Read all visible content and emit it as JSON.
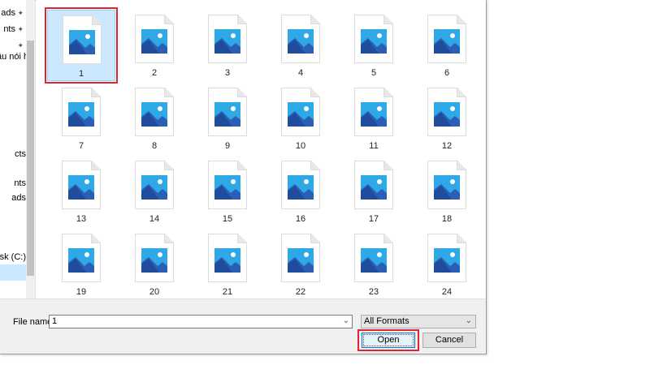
{
  "navigation": {
    "items": [
      {
        "label": "ads",
        "pinned": true
      },
      {
        "label": "nts",
        "pinned": true
      },
      {
        "label": "",
        "pinned": true
      },
      {
        "label": "âu nói h",
        "pinned": false
      },
      {
        "label": "cts",
        "pinned": false
      },
      {
        "label": "nts",
        "pinned": false
      },
      {
        "label": "ads",
        "pinned": false
      },
      {
        "label": "sk (C:)",
        "pinned": false
      }
    ],
    "pin_glyph": "📌"
  },
  "files": [
    {
      "name": "1",
      "selected": true
    },
    {
      "name": "2"
    },
    {
      "name": "3"
    },
    {
      "name": "4"
    },
    {
      "name": "5"
    },
    {
      "name": "6"
    },
    {
      "name": "7"
    },
    {
      "name": "8"
    },
    {
      "name": "9"
    },
    {
      "name": "10"
    },
    {
      "name": "11"
    },
    {
      "name": "12"
    },
    {
      "name": "13"
    },
    {
      "name": "14"
    },
    {
      "name": "15"
    },
    {
      "name": "16"
    },
    {
      "name": "17"
    },
    {
      "name": "18"
    },
    {
      "name": "19"
    },
    {
      "name": "20"
    },
    {
      "name": "21"
    },
    {
      "name": "22"
    },
    {
      "name": "23"
    },
    {
      "name": "24"
    }
  ],
  "file_icon": "image-file-icon",
  "bottom_bar": {
    "file_name_label": "File name:",
    "file_name_value": "1",
    "file_type": "All Formats",
    "open_label": "Open",
    "cancel_label": "Cancel"
  },
  "colors": {
    "selection": "#cce8ff",
    "highlight": "#e3232e",
    "image_sky": "#2ea8e6",
    "image_mountain": "#1f4d9c"
  }
}
